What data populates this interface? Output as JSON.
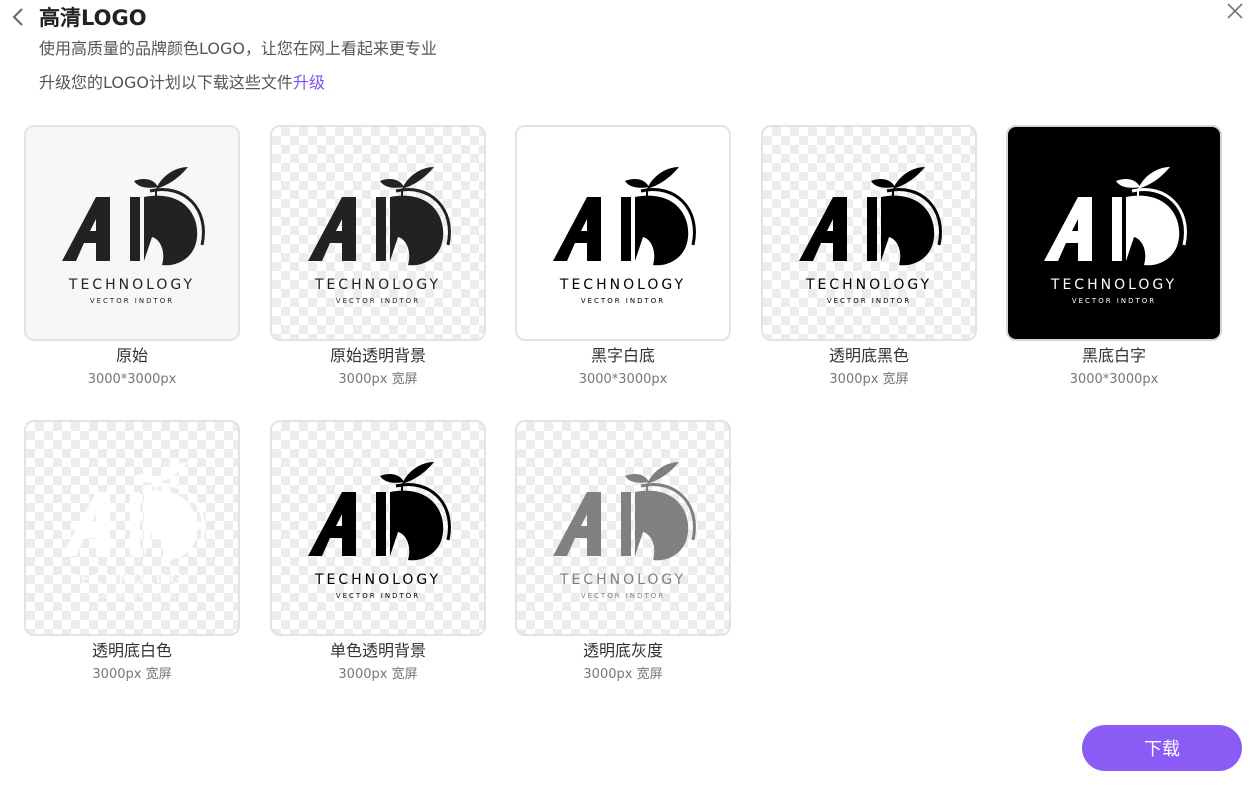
{
  "header": {
    "title": "高清LOGO",
    "subtitle": "使用高质量的品牌颜色LOGO，让您在网上看起来更专业",
    "upgrade_text": "升级您的LOGO计划以下载这些文件",
    "upgrade_link": "升级"
  },
  "logo": {
    "mark": "AI",
    "name": "TECHNOLOGY",
    "tagline": "VECTOR INDTOR"
  },
  "variants": [
    {
      "label": "原始",
      "size": "3000*3000px",
      "color": "#222222"
    },
    {
      "label": "原始透明背景",
      "size": "3000px 宽屏",
      "color": "#222222"
    },
    {
      "label": "黑字白底",
      "size": "3000*3000px",
      "color": "#000000"
    },
    {
      "label": "透明底黑色",
      "size": "3000px 宽屏",
      "color": "#000000"
    },
    {
      "label": "黑底白字",
      "size": "3000*3000px",
      "color": "#ffffff"
    },
    {
      "label": "透明底白色",
      "size": "3000px 宽屏",
      "color": "#ffffff"
    },
    {
      "label": "单色透明背景",
      "size": "3000px 宽屏",
      "color": "#000000"
    },
    {
      "label": "透明底灰度",
      "size": "3000px 宽屏",
      "color": "#808080"
    }
  ],
  "download_label": "下载",
  "colors": {
    "accent": "#8a5cf5",
    "link": "#7b4ff0"
  }
}
